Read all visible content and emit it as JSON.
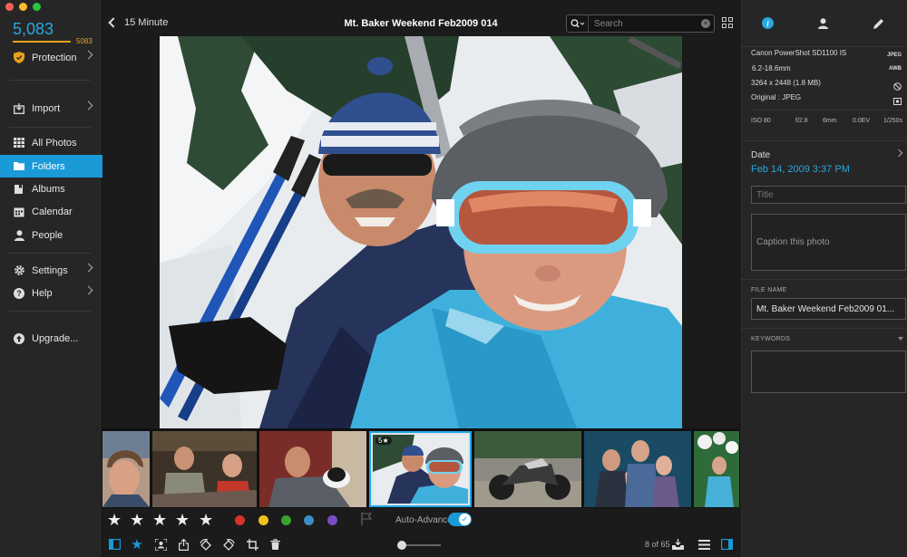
{
  "window": {
    "title": "Mt. Baker Weekend Feb2009 014"
  },
  "sidebar": {
    "photo_count": "5,083",
    "quota_count": "5083",
    "items": [
      {
        "label": "Protection",
        "icon": "shield-icon"
      },
      {
        "label": "Import",
        "icon": "import-icon"
      },
      {
        "label": "All Photos",
        "icon": "grid-icon"
      },
      {
        "label": "Folders",
        "icon": "folder-icon",
        "active": true
      },
      {
        "label": "Albums",
        "icon": "albums-icon"
      },
      {
        "label": "Calendar",
        "icon": "calendar-icon"
      },
      {
        "label": "People",
        "icon": "person-icon"
      },
      {
        "label": "Settings",
        "icon": "gear-icon"
      },
      {
        "label": "Help",
        "icon": "help-icon"
      },
      {
        "label": "Upgrade...",
        "icon": "upgrade-icon"
      }
    ]
  },
  "header": {
    "back_label": "15 Minute",
    "title": "Mt. Baker Weekend Feb2009 014",
    "search_placeholder": "Search"
  },
  "filmstrip": {
    "selected_badge": "5★",
    "thumbs": [
      "portrait-woman",
      "group-couch",
      "man-with-cat",
      "ski-lift-selfie",
      "motorcycle",
      "family-portrait",
      "party-balloons"
    ]
  },
  "rating": {
    "stars": 5,
    "colors": [
      "#d8322b",
      "#f0c419",
      "#3aa02f",
      "#3b8ec4",
      "#7a4cc4"
    ],
    "auto_advance_label": "Auto-Advance",
    "auto_advance_on": true
  },
  "toolbar": {
    "page_count": "8 of 65"
  },
  "info": {
    "camera": "Canon PowerShot SD1100 IS",
    "lens": "6.2-18.6mm",
    "dimensions": "3264 x 2448 (1.8 MB)",
    "original": "Original : JPEG",
    "format_badge": "JPEG",
    "wb_badge": "AWB",
    "iso": "ISO 80",
    "aperture": "f/2.8",
    "focal": "6mm",
    "exposure": "0.0EV",
    "shutter": "1/250s",
    "date_label": "Date",
    "date_value": "Feb 14, 2009 3:37 PM",
    "title_placeholder": "Title",
    "caption_placeholder": "Caption this photo",
    "file_name_label": "FILE NAME",
    "file_name_value": "Mt. Baker Weekend Feb2009 01...",
    "keywords_label": "KEYWORDS"
  }
}
